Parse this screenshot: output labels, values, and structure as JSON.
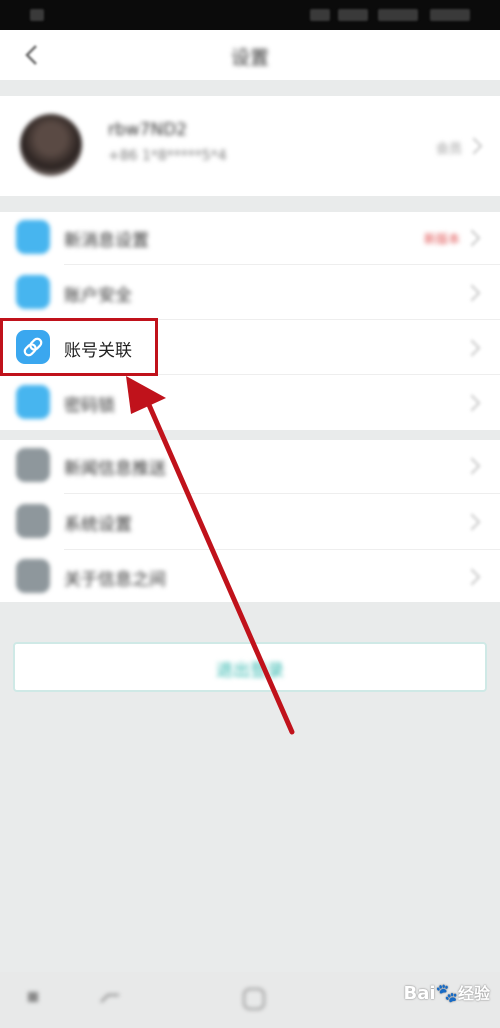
{
  "nav": {
    "title": "设置"
  },
  "profile": {
    "name": "rbw7ND2",
    "phone": "+86 1*8*****5*4",
    "extra": "会员"
  },
  "group1": [
    {
      "label": "新消息设置",
      "badge": "新版本"
    },
    {
      "label": "账户安全"
    },
    {
      "label": "账号关联"
    },
    {
      "label": "密码锁"
    }
  ],
  "group2": [
    {
      "label": "新闻信息推送"
    },
    {
      "label": "系统设置"
    },
    {
      "label": "关于信息之间"
    }
  ],
  "logout": {
    "label": "退出登录"
  },
  "watermark": {
    "brand": "Bai",
    "suffix": "经验"
  },
  "colors": {
    "accent_red": "#c0121b",
    "icon_blue": "#47b5ef",
    "logout_teal": "#35b8b0"
  },
  "icons": {
    "link": "link-icon",
    "back": "back-arrow-icon"
  }
}
